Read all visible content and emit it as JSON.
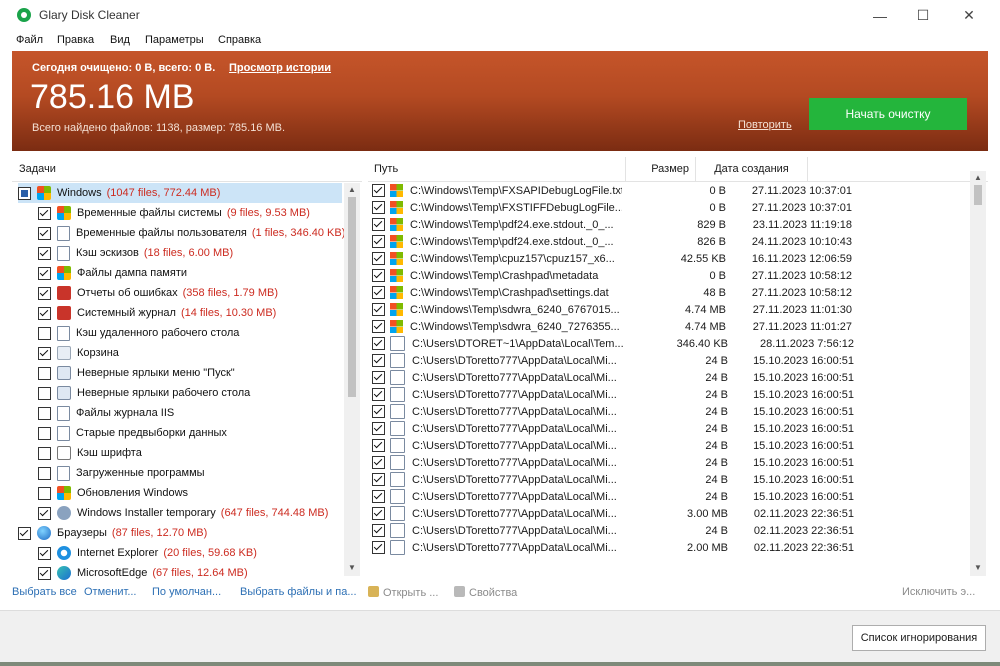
{
  "window": {
    "title": "Glary Disk Cleaner",
    "min": "—",
    "max": "☐",
    "close": "✕"
  },
  "menu": [
    "Файл",
    "Правка",
    "Вид",
    "Параметры",
    "Справка"
  ],
  "banner": {
    "today_text": "Сегодня очищено: 0 B, всего: 0 B.",
    "history_link": "Просмотр истории",
    "total_size": "785.16 MB",
    "found_text": "Всего найдено файлов: 1138, размер: 785.16 MB.",
    "repeat_link": "Повторить",
    "start_button": "Начать очистку"
  },
  "tasks": {
    "header": "Задачи",
    "items": [
      {
        "label": "Windows",
        "count": "(1047 files, 772.44 MB)",
        "state": "partial",
        "icon": "windows-icon",
        "level": 0,
        "selected": true
      },
      {
        "label": "Временные файлы системы",
        "count": "(9 files, 9.53 MB)",
        "state": "checked",
        "icon": "windows-icon",
        "level": 1
      },
      {
        "label": "Временные файлы пользователя",
        "count": "(1 files, 346.40 KB)",
        "state": "checked",
        "icon": "file-icon",
        "level": 1
      },
      {
        "label": "Кэш эскизов",
        "count": "(18 files, 6.00 MB)",
        "state": "checked",
        "icon": "file-icon",
        "level": 1
      },
      {
        "label": "Файлы дампа памяти",
        "count": "",
        "state": "checked",
        "icon": "windows-icon",
        "level": 1
      },
      {
        "label": "Отчеты об ошибках",
        "count": "(358 files, 1.79 MB)",
        "state": "checked",
        "icon": "error-report-icon",
        "level": 1
      },
      {
        "label": "Системный журнал",
        "count": "(14 files, 10.30 MB)",
        "state": "checked",
        "icon": "log-icon",
        "level": 1
      },
      {
        "label": "Кэш удаленного рабочего стола",
        "count": "",
        "state": "unchecked",
        "icon": "remote-desktop-icon",
        "level": 1
      },
      {
        "label": "Корзина",
        "count": "",
        "state": "checked",
        "icon": "recycle-bin-icon",
        "level": 1
      },
      {
        "label": "Неверные ярлыки меню \"Пуск\"",
        "count": "",
        "state": "unchecked",
        "icon": "shortcut-icon",
        "level": 1
      },
      {
        "label": "Неверные ярлыки рабочего стола",
        "count": "",
        "state": "unchecked",
        "icon": "shortcut-icon",
        "level": 1
      },
      {
        "label": "Файлы журнала IIS",
        "count": "",
        "state": "unchecked",
        "icon": "file-icon",
        "level": 1
      },
      {
        "label": "Старые предвыборки данных",
        "count": "",
        "state": "unchecked",
        "icon": "file-icon",
        "level": 1
      },
      {
        "label": "Кэш шрифта",
        "count": "",
        "state": "unchecked",
        "icon": "font-icon",
        "level": 1
      },
      {
        "label": "Загруженные программы",
        "count": "",
        "state": "unchecked",
        "icon": "file-icon",
        "level": 1
      },
      {
        "label": "Обновления Windows",
        "count": "",
        "state": "unchecked",
        "icon": "windows-icon",
        "level": 1
      },
      {
        "label": "Windows Installer temporary",
        "count": "(647 files, 744.48 MB)",
        "state": "checked",
        "icon": "installer-icon",
        "level": 1
      },
      {
        "label": "Браузеры",
        "count": "(87 files, 12.70 MB)",
        "state": "checked",
        "icon": "globe-icon",
        "level": 0
      },
      {
        "label": "Internet Explorer",
        "count": "(20 files, 59.68 KB)",
        "state": "checked",
        "icon": "ie-icon",
        "level": 1
      },
      {
        "label": "MicrosoftEdge",
        "count": "(67 files, 12.64 MB)",
        "state": "checked",
        "icon": "edge-icon",
        "level": 1
      }
    ]
  },
  "files": {
    "columns": {
      "path": "Путь",
      "size": "Размер",
      "date": "Дата создания"
    },
    "rows": [
      {
        "path": "C:\\Windows\\Temp\\FXSAPIDebugLogFile.txt",
        "size": "0 B",
        "date": "27.11.2023 10:37:01",
        "icon": "windows-icon"
      },
      {
        "path": "C:\\Windows\\Temp\\FXSTIFFDebugLogFile...",
        "size": "0 B",
        "date": "27.11.2023 10:37:01",
        "icon": "windows-icon"
      },
      {
        "path": "C:\\Windows\\Temp\\pdf24.exe.stdout._0_...",
        "size": "829 B",
        "date": "23.11.2023 11:19:18",
        "icon": "windows-icon"
      },
      {
        "path": "C:\\Windows\\Temp\\pdf24.exe.stdout._0_...",
        "size": "826 B",
        "date": "24.11.2023 10:10:43",
        "icon": "windows-icon"
      },
      {
        "path": "C:\\Windows\\Temp\\cpuz157\\cpuz157_x6...",
        "size": "42.55 KB",
        "date": "16.11.2023 12:06:59",
        "icon": "windows-icon"
      },
      {
        "path": "C:\\Windows\\Temp\\Crashpad\\metadata",
        "size": "0 B",
        "date": "27.11.2023 10:58:12",
        "icon": "windows-icon"
      },
      {
        "path": "C:\\Windows\\Temp\\Crashpad\\settings.dat",
        "size": "48 B",
        "date": "27.11.2023 10:58:12",
        "icon": "windows-icon"
      },
      {
        "path": "C:\\Windows\\Temp\\sdwra_6240_6767015...",
        "size": "4.74 MB",
        "date": "27.11.2023 11:01:30",
        "icon": "windows-icon"
      },
      {
        "path": "C:\\Windows\\Temp\\sdwra_6240_7276355...",
        "size": "4.74 MB",
        "date": "27.11.2023 11:01:27",
        "icon": "windows-icon"
      },
      {
        "path": "C:\\Users\\DTORET~1\\AppData\\Local\\Tem...",
        "size": "346.40 KB",
        "date": "28.11.2023 7:56:12",
        "icon": "file-icon"
      },
      {
        "path": "C:\\Users\\DToretto777\\AppData\\Local\\Mi...",
        "size": "24 B",
        "date": "15.10.2023 16:00:51",
        "icon": "file-icon"
      },
      {
        "path": "C:\\Users\\DToretto777\\AppData\\Local\\Mi...",
        "size": "24 B",
        "date": "15.10.2023 16:00:51",
        "icon": "file-icon"
      },
      {
        "path": "C:\\Users\\DToretto777\\AppData\\Local\\Mi...",
        "size": "24 B",
        "date": "15.10.2023 16:00:51",
        "icon": "file-icon"
      },
      {
        "path": "C:\\Users\\DToretto777\\AppData\\Local\\Mi...",
        "size": "24 B",
        "date": "15.10.2023 16:00:51",
        "icon": "file-icon"
      },
      {
        "path": "C:\\Users\\DToretto777\\AppData\\Local\\Mi...",
        "size": "24 B",
        "date": "15.10.2023 16:00:51",
        "icon": "file-icon"
      },
      {
        "path": "C:\\Users\\DToretto777\\AppData\\Local\\Mi...",
        "size": "24 B",
        "date": "15.10.2023 16:00:51",
        "icon": "file-icon"
      },
      {
        "path": "C:\\Users\\DToretto777\\AppData\\Local\\Mi...",
        "size": "24 B",
        "date": "15.10.2023 16:00:51",
        "icon": "file-icon"
      },
      {
        "path": "C:\\Users\\DToretto777\\AppData\\Local\\Mi...",
        "size": "24 B",
        "date": "15.10.2023 16:00:51",
        "icon": "file-icon"
      },
      {
        "path": "C:\\Users\\DToretto777\\AppData\\Local\\Mi...",
        "size": "24 B",
        "date": "15.10.2023 16:00:51",
        "icon": "file-icon"
      },
      {
        "path": "C:\\Users\\DToretto777\\AppData\\Local\\Mi...",
        "size": "3.00 MB",
        "date": "02.11.2023 22:36:51",
        "icon": "file-icon"
      },
      {
        "path": "C:\\Users\\DToretto777\\AppData\\Local\\Mi...",
        "size": "24 B",
        "date": "02.11.2023 22:36:51",
        "icon": "file-icon"
      },
      {
        "path": "C:\\Users\\DToretto777\\AppData\\Local\\Mi...",
        "size": "2.00 MB",
        "date": "02.11.2023 22:36:51",
        "icon": "file-icon"
      }
    ]
  },
  "bottom": {
    "select_all": "Выбрать все",
    "deselect": "Отменит...",
    "default": "По умолчан...",
    "select_files": "Выбрать файлы и па...",
    "open": "Открыть ...",
    "properties": "Свойства",
    "exclude": "Исключить э..."
  },
  "footer": {
    "ignore_list": "Список игнорирования"
  },
  "colors": {
    "accent_orange": "#c5552a",
    "start_green": "#24b53c",
    "count_red": "#cc2b20",
    "link_blue": "#2c6fb4"
  }
}
